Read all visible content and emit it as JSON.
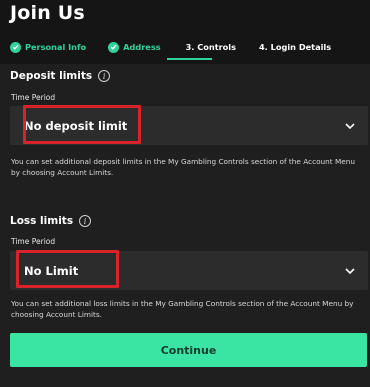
{
  "header": {
    "title": "Join Us",
    "steps": [
      {
        "label": "Personal Info",
        "status": "completed"
      },
      {
        "label": "Address",
        "status": "completed"
      },
      {
        "label": "3. Controls",
        "status": "active"
      },
      {
        "label": "4. Login Details",
        "status": "upcoming"
      }
    ]
  },
  "deposit": {
    "heading": "Deposit limits",
    "time_period_label": "Time Period",
    "selected_value": "No deposit limit",
    "help_text": "You can set additional deposit limits in the My Gambling Controls section of the Account Menu by choosing Account Limits."
  },
  "loss": {
    "heading": "Loss limits",
    "time_period_label": "Time Period",
    "selected_value": "No Limit",
    "help_text": "You can set additional loss limits in the My Gambling Controls section of the Account Menu by choosing Account Limits."
  },
  "actions": {
    "continue_label": "Continue"
  },
  "colors": {
    "accent": "#2fd39a",
    "button": "#3ae5a3",
    "highlight": "#d8232a",
    "background": "#1f1f1f"
  },
  "icons": {
    "info": "info-icon",
    "check": "check-icon",
    "chevron": "chevron-down-icon"
  }
}
